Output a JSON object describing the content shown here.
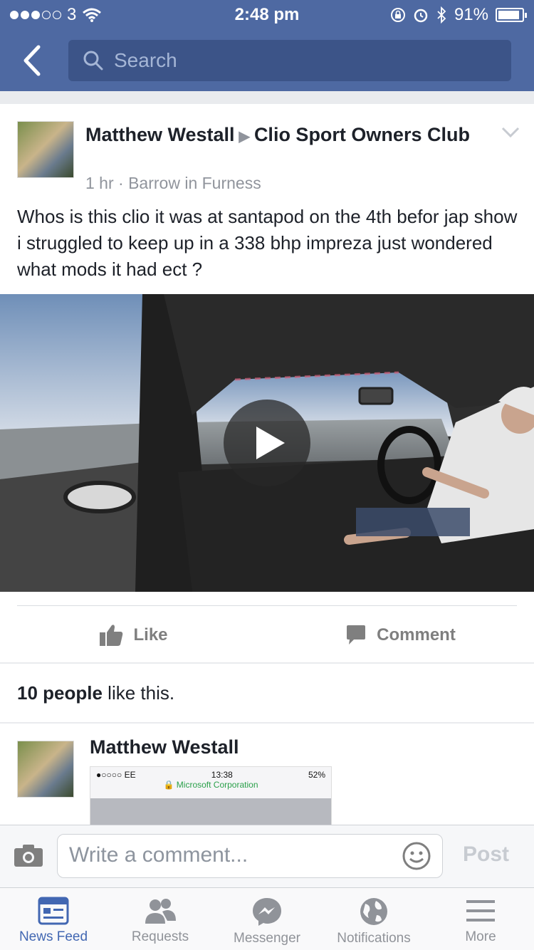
{
  "status_bar": {
    "carrier": "3",
    "time": "2:48 pm",
    "battery": "91%",
    "battery_level": 0.91
  },
  "header": {
    "search_placeholder": "Search"
  },
  "post": {
    "author": "Matthew Westall",
    "group": "Clio Sport Owners Club",
    "time": "1 hr",
    "separator": "·",
    "location": "Barrow in Furness",
    "text": "Whos is this clio it was at santapod on the 4th befor jap show i struggled to keep up in a 338 bhp impreza just wondered what mods it had ect ?",
    "actions": {
      "like": "Like",
      "comment": "Comment"
    },
    "likes": {
      "count": "10 people",
      "suffix": " like this."
    }
  },
  "comment": {
    "author": "Matthew Westall",
    "attachment": {
      "status_left": "●○○○○ EE",
      "time": "13:38",
      "battery": "52%",
      "site": "Microsoft Corporation"
    }
  },
  "composer": {
    "placeholder": "Write a comment...",
    "post_label": "Post"
  },
  "tabs": [
    {
      "label": "News Feed",
      "icon": "news-feed-icon",
      "active": true
    },
    {
      "label": "Requests",
      "icon": "friend-requests-icon",
      "active": false
    },
    {
      "label": "Messenger",
      "icon": "messenger-icon",
      "active": false
    },
    {
      "label": "Notifications",
      "icon": "globe-icon",
      "active": false
    },
    {
      "label": "More",
      "icon": "menu-icon",
      "active": false
    }
  ],
  "colors": {
    "header": "#4e69a2",
    "search_bg": "#3c5488",
    "active_tab": "#4267b2",
    "muted": "#90949c"
  }
}
